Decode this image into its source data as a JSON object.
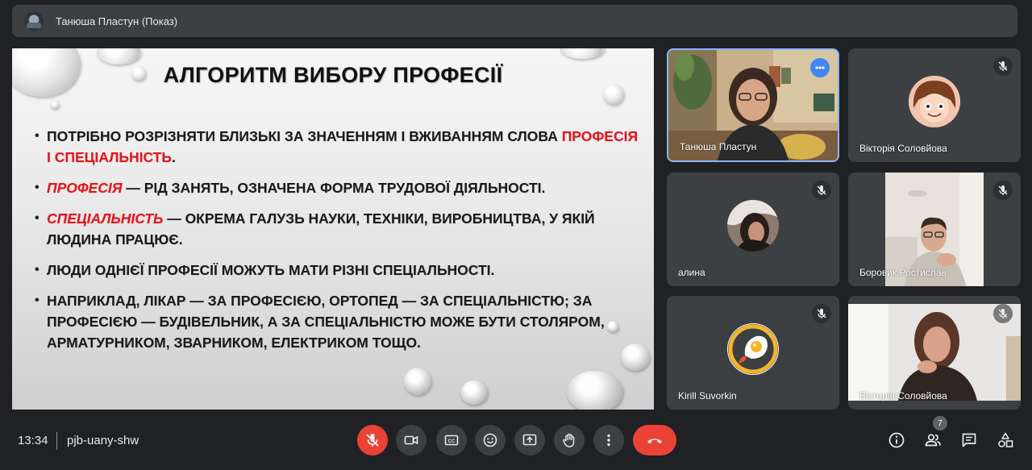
{
  "topbar": {
    "presenter_title": "Танюша Пластун (Показ)"
  },
  "slide": {
    "title": "АЛГОРИТМ ВИБОРУ ПРОФЕСІЇ",
    "bullets": [
      {
        "text1": "ПОТРІБНО РОЗРІЗНЯТИ БЛИЗЬКІ ЗА ЗНАЧЕННЯМ І ВЖИВАННЯМ СЛОВА ",
        "highlight": "ПРОФЕСІЯ І СПЕЦІАЛЬНІСТЬ",
        "text2": "."
      },
      {
        "term": "ПРОФЕСІЯ",
        "text": " — РІД ЗАНЯТЬ, ОЗНАЧЕНА ФОРМА ТРУДОВОЇ ДІЯЛЬНОСТІ."
      },
      {
        "term": "СПЕЦІАЛЬНІСТЬ",
        "text": " — ОКРЕМА ГАЛУЗЬ НАУКИ, ТЕХНІКИ, ВИРОБНИЦТВА, У ЯКІЙ ЛЮДИНА ПРАЦЮЄ."
      },
      {
        "text": "ЛЮДИ ОДНІЄЇ ПРОФЕСІЇ МОЖУТЬ МАТИ РІЗНІ СПЕЦІАЛЬНОСТІ."
      },
      {
        "text": "НАПРИКЛАД, ЛІКАР — ЗА ПРОФЕСІЄЮ, ОРТОПЕД — ЗА СПЕЦІАЛЬНІСТЮ; ЗА ПРОФЕСІЄЮ — БУДІВЕЛЬНИК, А ЗА СПЕЦІАЛЬНІСТЮ МОЖЕ БУТИ СТОЛЯРОМ, АРМАТУРНИКОМ, ЗВАРНИКОМ, ЕЛЕКТРИКОМ ТОЩО."
      }
    ]
  },
  "participants": [
    {
      "name": "Танюша Пластун",
      "muted": false,
      "active_speaker": true,
      "menu_icon": "more-dots-icon"
    },
    {
      "name": "Вікторія Соловйова",
      "muted": true,
      "avatar": "cartoon-girl-avatar"
    },
    {
      "name": "алина",
      "muted": true,
      "avatar": "photo-avatar"
    },
    {
      "name": "Боровик Ростислав",
      "muted": true,
      "video": true
    },
    {
      "name": "Kirill Suvorkin",
      "muted": true,
      "avatar": "fried-egg-rocket-avatar"
    },
    {
      "name": "Вікторія Соловйова",
      "muted": true,
      "video": true
    }
  ],
  "bottombar": {
    "time": "13:34",
    "meeting_code": "pjb-uany-shw",
    "people_count": "7",
    "controls": [
      "mic-off-icon",
      "camera-icon",
      "captions-icon",
      "emoji-icon",
      "present-screen-icon",
      "raise-hand-icon",
      "more-vert-icon",
      "end-call-icon"
    ],
    "right_icons": [
      "info-icon",
      "people-icon",
      "chat-icon",
      "activities-icon"
    ]
  },
  "colors": {
    "accent_red": "#ea4335",
    "active_border": "#8ab4f8",
    "tile_bg": "#3c4043",
    "slide_red": "#e8141b"
  }
}
